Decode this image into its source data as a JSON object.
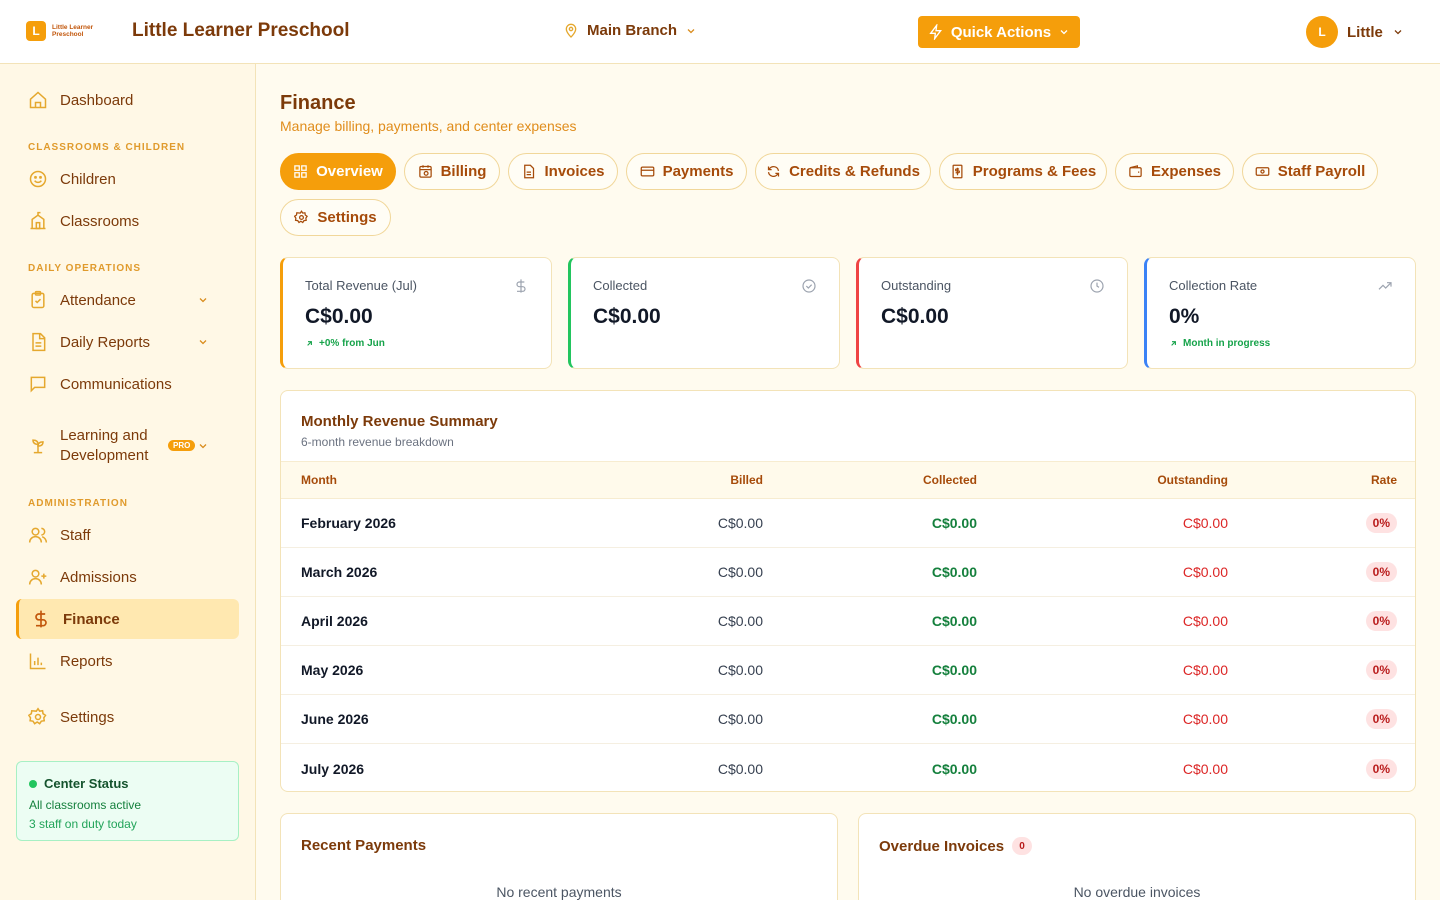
{
  "header": {
    "logo_letter": "L",
    "logo_text": "Little Learner Preschool",
    "app_title": "Little Learner Preschool",
    "branch": "Main Branch",
    "quick_actions": "Quick Actions",
    "user_initial": "L",
    "user_name": "Little"
  },
  "sidebar": {
    "dashboard": "Dashboard",
    "section_classrooms": "CLASSROOMS & CHILDREN",
    "children": "Children",
    "classrooms": "Classrooms",
    "section_daily": "DAILY OPERATIONS",
    "attendance": "Attendance",
    "daily_reports": "Daily Reports",
    "communications": "Communications",
    "learning": "Learning and Development",
    "pro_badge": "PRO",
    "section_admin": "ADMINISTRATION",
    "staff": "Staff",
    "admissions": "Admissions",
    "finance": "Finance",
    "reports": "Reports",
    "settings": "Settings",
    "status": {
      "title": "Center Status",
      "line1": "All classrooms active",
      "line2": "3 staff on duty today"
    }
  },
  "page": {
    "title": "Finance",
    "subtitle": "Manage billing, payments, and center expenses"
  },
  "tabs": {
    "overview": "Overview",
    "billing": "Billing",
    "invoices": "Invoices",
    "payments": "Payments",
    "credits": "Credits & Refunds",
    "programs": "Programs & Fees",
    "expenses": "Expenses",
    "payroll": "Staff Payroll",
    "settings": "Settings"
  },
  "stats": {
    "revenue": {
      "label": "Total Revenue (Jul)",
      "value": "C$0.00",
      "note": "+0% from Jun"
    },
    "collected": {
      "label": "Collected",
      "value": "C$0.00"
    },
    "outstanding": {
      "label": "Outstanding",
      "value": "C$0.00"
    },
    "rate": {
      "label": "Collection Rate",
      "value": "0%",
      "note": "Month in progress"
    }
  },
  "revenue_summary": {
    "title": "Monthly Revenue Summary",
    "subtitle": "6-month revenue breakdown",
    "columns": {
      "month": "Month",
      "billed": "Billed",
      "collected": "Collected",
      "outstanding": "Outstanding",
      "rate": "Rate"
    },
    "rows": [
      {
        "month": "February 2026",
        "billed": "C$0.00",
        "collected": "C$0.00",
        "outstanding": "C$0.00",
        "rate": "0%"
      },
      {
        "month": "March 2026",
        "billed": "C$0.00",
        "collected": "C$0.00",
        "outstanding": "C$0.00",
        "rate": "0%"
      },
      {
        "month": "April 2026",
        "billed": "C$0.00",
        "collected": "C$0.00",
        "outstanding": "C$0.00",
        "rate": "0%"
      },
      {
        "month": "May 2026",
        "billed": "C$0.00",
        "collected": "C$0.00",
        "outstanding": "C$0.00",
        "rate": "0%"
      },
      {
        "month": "June 2026",
        "billed": "C$0.00",
        "collected": "C$0.00",
        "outstanding": "C$0.00",
        "rate": "0%"
      },
      {
        "month": "July 2026",
        "billed": "C$0.00",
        "collected": "C$0.00",
        "outstanding": "C$0.00",
        "rate": "0%"
      }
    ]
  },
  "recent_payments": {
    "title": "Recent Payments",
    "empty": "No recent payments"
  },
  "overdue_invoices": {
    "title": "Overdue Invoices",
    "count": "0",
    "empty": "No overdue invoices"
  },
  "colors": {
    "accent": "#f59e0b",
    "revenue_border": "#f59e0b",
    "collected_border": "#22c55e",
    "outstanding_border": "#ef4444",
    "rate_border": "#3b82f6"
  }
}
